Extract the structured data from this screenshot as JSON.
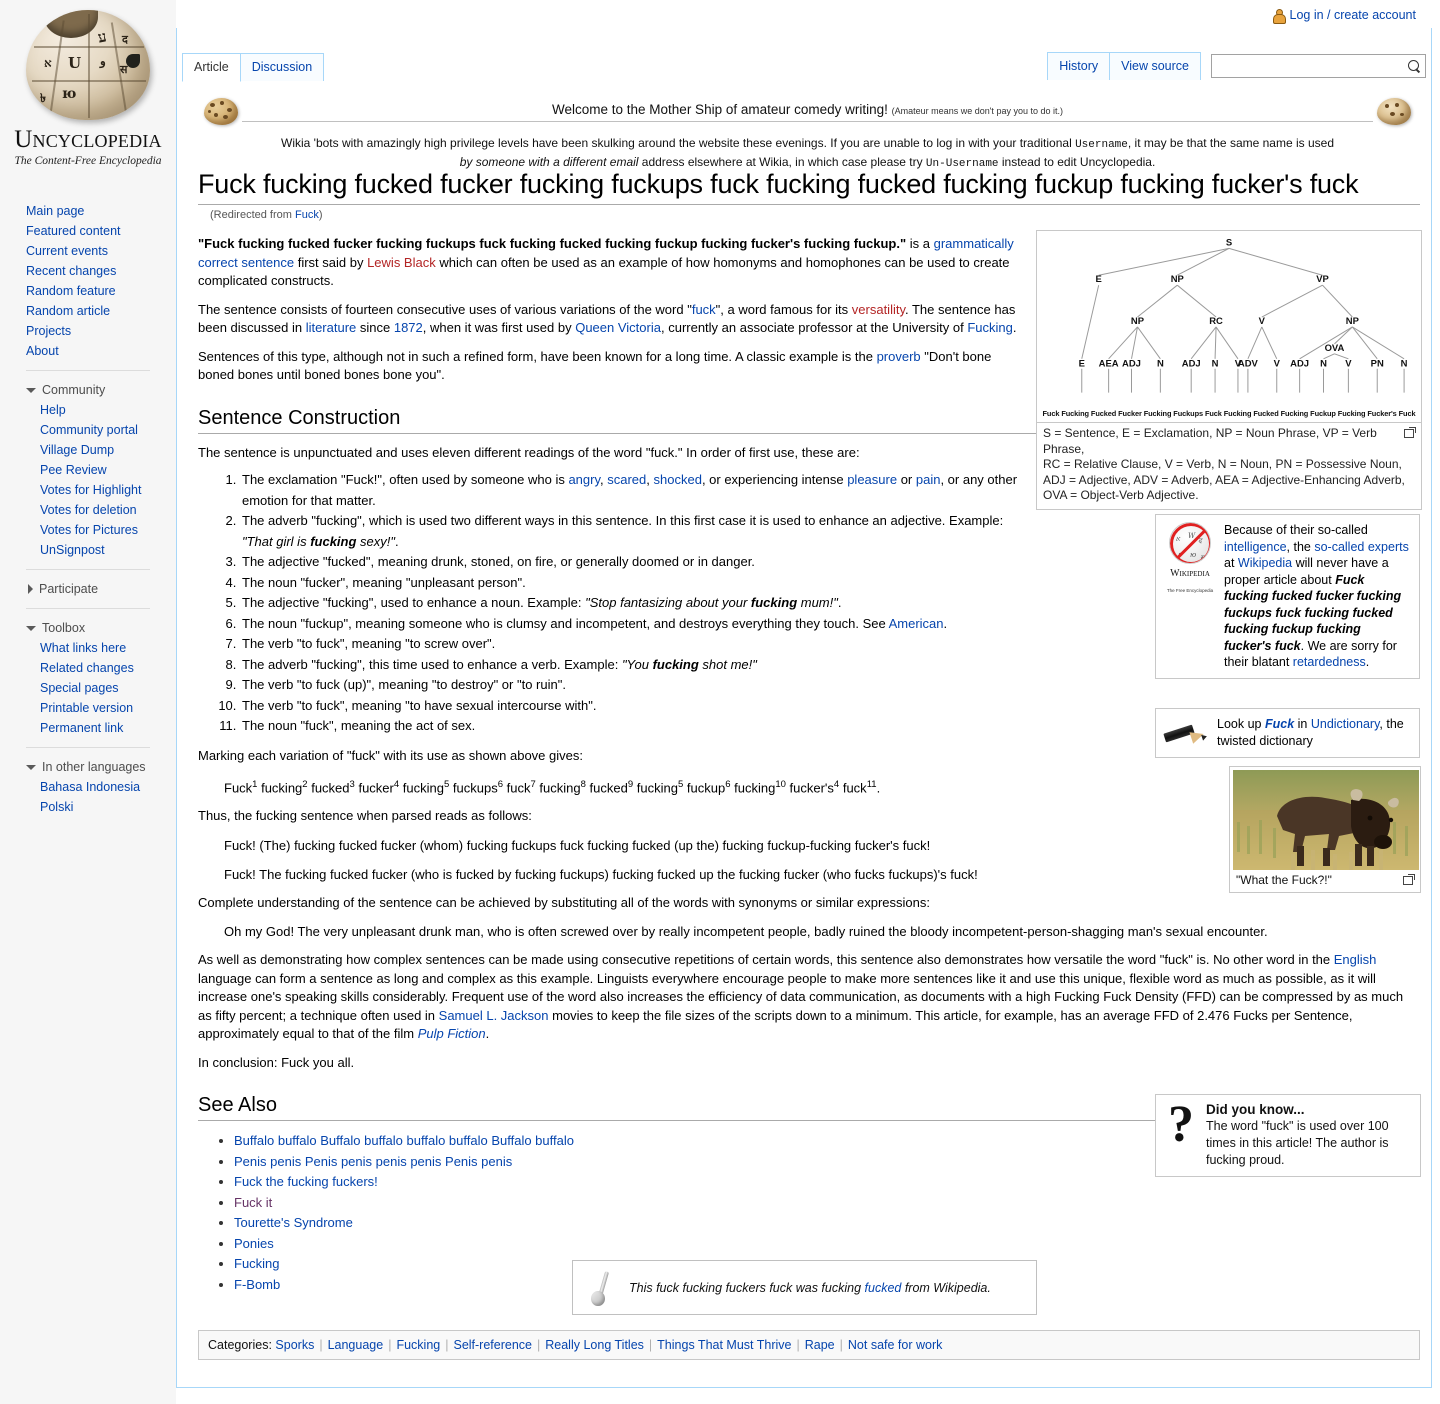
{
  "userbar": {
    "login_label": "Log in / create account"
  },
  "tabs": {
    "left": [
      {
        "label": "Article",
        "active": true
      },
      {
        "label": "Discussion",
        "active": false
      }
    ],
    "right": [
      {
        "label": "History"
      },
      {
        "label": "View source"
      }
    ]
  },
  "search": {
    "value": "",
    "placeholder": ""
  },
  "logo": {
    "name": "Uncyclopedia",
    "tagline": "The Content-Free Encyclopedia"
  },
  "sidebar": {
    "main_links": [
      "Main page",
      "Featured content",
      "Current events",
      "Recent changes",
      "Random feature",
      "Random article",
      "Projects",
      "About"
    ],
    "groups": [
      {
        "title": "Community",
        "expanded": true,
        "items": [
          "Help",
          "Community portal",
          "Village Dump",
          "Pee Review",
          "Votes for Highlight",
          "Votes for deletion",
          "Votes for Pictures",
          "UnSignpost"
        ]
      },
      {
        "title": "Participate",
        "expanded": false,
        "items": []
      },
      {
        "title": "Toolbox",
        "expanded": true,
        "items": [
          "What links here",
          "Related changes",
          "Special pages",
          "Printable version",
          "Permanent link"
        ]
      },
      {
        "title": "In other languages",
        "expanded": true,
        "items": [
          "Bahasa Indonesia",
          "Polski"
        ]
      }
    ]
  },
  "notice": {
    "headline": "Welcome to the Mother Ship of amateur comedy writing!",
    "headline_small": "(Amateur means we don't pay you to do it.)",
    "body_line1_a": "Wikia 'bots with amazingly high privilege levels have been skulking around the website these evenings. If you are unable to log in with your traditional ",
    "body_line1_mono": "Username",
    "body_line1_b": ", it may be that the same name is used",
    "body_line2_a": "by someone with a different email",
    "body_line2_b": " address elsewhere at Wikia, in which case please try ",
    "body_line2_mono": "Un-Username",
    "body_line2_c": " instead to edit Uncyclopedia."
  },
  "article": {
    "title": "Fuck fucking fucked fucker fucking fuckups fuck fucking fucked fucking fuckup fucking fucker's fuck",
    "redirect_prefix": "(Redirected from ",
    "redirect_link": "Fuck",
    "redirect_suffix": ")",
    "p1": {
      "quote": "\"Fuck fucking fucked fucker fucking fuckups fuck fucking fucked fucking fuckup fucking fucker's fucking fuckup.\"",
      "a": " is a ",
      "link1": "grammatically correct sentence",
      "b": " first said by ",
      "link2": "Lewis Black",
      "c": " which can often be used as an example of how homonyms and homophones can be used to create complicated constructs."
    },
    "p2": {
      "a": "The sentence consists of fourteen consecutive uses of various variations of the word \"",
      "link1": "fuck",
      "b": "\", a word famous for its ",
      "link2": "versatility",
      "c": ". The sentence has been discussed in ",
      "link3": "literature",
      "d": " since ",
      "link4": "1872",
      "e": ", when it was first used by ",
      "link5": "Queen Victoria",
      "f": ", currently an associate professor at the University of ",
      "link6": "Fucking",
      "g": "."
    },
    "p3": {
      "a": "Sentences of this type, although not in such a refined form, have been known for a long time. A classic example is the ",
      "link1": "proverb",
      "b": " \"Don't bone boned bones until boned bones bone you\"."
    },
    "section_construction": "Sentence Construction",
    "p4": "The sentence is unpunctuated and uses eleven different readings of the word \"fuck.\" In order of first use, these are:",
    "readings": [
      {
        "pre": "The exclamation \"Fuck!\", often used by someone who is ",
        "links": [
          "angry",
          "scared",
          "shocked"
        ],
        "mid": ", or experiencing intense ",
        "links2": [
          "pleasure",
          "pain"
        ],
        "post": ", or any other emotion for that matter."
      },
      {
        "pre": "The adverb \"fucking\", which is used two different ways in this sentence. In this first case it is used to enhance an adjective. Example: ",
        "italic_a": "\"That girl is ",
        "bold_italic": "fucking",
        "italic_b": " sexy!\"",
        "post": "."
      },
      {
        "text": "The adjective \"fucked\", meaning drunk, stoned, on fire, or generally doomed or in danger."
      },
      {
        "text": "The noun \"fucker\", meaning \"unpleasant person\"."
      },
      {
        "pre": "The adjective \"fucking\", used to enhance a noun. Example: ",
        "italic_a": "\"Stop fantasizing about your ",
        "bold_italic": "fucking",
        "italic_b": " mum!\"",
        "post": "."
      },
      {
        "pre": "The noun \"fuckup\", meaning someone who is clumsy and incompetent, and destroys everything they touch. See ",
        "links": [
          "American"
        ],
        "post": "."
      },
      {
        "text": "The verb \"to fuck\", meaning \"to screw over\"."
      },
      {
        "pre": "The adverb \"fucking\", this time used to enhance a verb. Example: ",
        "italic_a": "\"You ",
        "bold_italic": "fucking",
        "italic_b": " shot me!\"",
        "post": ""
      },
      {
        "text": "The verb \"to fuck (up)\", meaning \"to destroy\" or \"to ruin\"."
      },
      {
        "text": "The verb \"to fuck\", meaning \"to have sexual intercourse with\"."
      },
      {
        "text": "The noun \"fuck\", meaning the act of sex."
      }
    ],
    "p5": "Marking each variation of \"fuck\" with its use as shown above gives:",
    "marked_sentence": [
      {
        "w": "Fuck",
        "s": "1"
      },
      {
        "w": "fucking",
        "s": "2"
      },
      {
        "w": "fucked",
        "s": "3"
      },
      {
        "w": "fucker",
        "s": "4"
      },
      {
        "w": "fucking",
        "s": "5"
      },
      {
        "w": "fuckups",
        "s": "6"
      },
      {
        "w": "fuck",
        "s": "7"
      },
      {
        "w": "fucking",
        "s": "8"
      },
      {
        "w": "fucked",
        "s": "9"
      },
      {
        "w": "fucking",
        "s": "5"
      },
      {
        "w": "fuckup",
        "s": "6"
      },
      {
        "w": "fucking",
        "s": "10"
      },
      {
        "w": "fucker's",
        "s": "4"
      },
      {
        "w": "fuck",
        "s": "11"
      }
    ],
    "marked_end": ".",
    "p6": "Thus, the fucking sentence when parsed reads as follows:",
    "parse1": "Fuck! (The) fucking fucked fucker (whom) fucking fuckups fuck fucking fucked (up the) fucking fuckup-fucking fucker's fuck!",
    "parse2": "Fuck! The fucking fucked fucker (who is fucked by fucking fuckups) fucking fucked up the fucking fucker (who fucks fuckups)'s fuck!",
    "p7": "Complete understanding of the sentence can be achieved by substituting all of the words with synonyms or similar expressions:",
    "synonym_line": "Oh my God! The very unpleasant drunk man, who is often screwed over by really incompetent people, badly ruined the bloody incompetent-person-shagging man's sexual encounter.",
    "p8": {
      "a": "As well as demonstrating how complex sentences can be made using consecutive repetitions of certain words, this sentence also demonstrates how versatile the word \"fuck\" is. No other word in the ",
      "link1": "English",
      "b": " language can form a sentence as long and complex as this example. Linguists everywhere encourage people to make more sentences like it and use this unique, flexible word as much as possible, as it will increase one's speaking skills considerably. Frequent use of the word also increases the efficiency of data communication, as documents with a high Fucking Fuck Density (FFD) can be compressed by as much as fifty percent; a technique often used in ",
      "link2": "Samuel L. Jackson",
      "c": " movies to keep the file sizes of the scripts down to a minimum. This article, for example, has an average FFD of 2.476 Fucks per Sentence, approximately equal to that of the film ",
      "link3_italic": "Pulp Fiction",
      "d": "."
    },
    "p9": "In conclusion: Fuck you all.",
    "section_seealso": "See Also",
    "seealso": [
      {
        "label": "Buffalo buffalo Buffalo buffalo buffalo buffalo Buffalo buffalo",
        "visited": false
      },
      {
        "label": "Penis penis Penis penis penis penis Penis penis",
        "visited": false
      },
      {
        "label": "Fuck the fucking fuckers!",
        "visited": false
      },
      {
        "label": "Fuck it",
        "visited": true
      },
      {
        "label": "Tourette's Syndrome",
        "visited": false
      },
      {
        "label": "Ponies",
        "visited": false
      },
      {
        "label": "Fucking",
        "visited": false
      },
      {
        "label": "F-Bomb",
        "visited": false
      }
    ]
  },
  "tree": {
    "legend_line1": "S = Sentence, E = Exclamation, NP = Noun Phrase, VP = Verb Phrase,",
    "legend_line2": "RC = Relative Clause, V = Verb, N = Noun, PN = Possessive Noun,",
    "legend_line3": "ADJ = Adjective, ADV = Adverb, AEA = Adjective-Enhancing Adverb,",
    "legend_line4": "OVA = Object-Verb Adjective.",
    "leaf_words": "Fuck Fucking Fucked Fucker Fucking Fuckups Fuck Fucking Fucked Fucking Fuckup Fucking Fucker's Fuck",
    "nodes": {
      "root": "S",
      "level2": [
        "E",
        "NP",
        "VP"
      ],
      "level3": [
        "NP",
        "RC",
        "V",
        "NP"
      ],
      "ova": "OVA",
      "pos": [
        "E",
        "AEA",
        "ADJ",
        "N",
        "ADJ",
        "N",
        "V",
        "ADV",
        "V",
        "ADJ",
        "N",
        "V",
        "PN",
        "N"
      ]
    }
  },
  "wikibox": {
    "a": "Because of their so-called ",
    "link1": "intelligence",
    "b": ", the ",
    "link2": "so-called experts",
    "c": " at ",
    "link3": "Wikipedia",
    "d": " will never have a proper article about ",
    "bold_italic": "Fuck fucking fucked fucker fucking fuckups fuck fucking fucked fucking fuckup fucking fucker's fuck",
    "e": ". We are sorry for their blatant ",
    "link4": "retardedness",
    "f": ".",
    "logo_word": "Wikipedia",
    "logo_sub": "The Free Encyclopedia"
  },
  "undictbox": {
    "a": "Look up ",
    "bold_italic": "Fuck",
    "b": " in ",
    "link": "Undictionary",
    "c": ", the twisted dictionary"
  },
  "thumb": {
    "caption": "\"What the Fuck?!\""
  },
  "dyk": {
    "title": "Did you know...",
    "text": "The word \"fuck\" is used over 100 times in this article! The author is fucking proud."
  },
  "spork": {
    "a": "This fuck fucking fuckers fuck was fucking ",
    "link": "fucked",
    "b": " from Wikipedia."
  },
  "categories": {
    "label": "Categories:",
    "items": [
      "Sporks",
      "Language",
      "Fucking",
      "Self-reference",
      "Really Long Titles",
      "Things That Must Thrive",
      "Rape",
      "Not safe for work"
    ]
  },
  "colors": {
    "link": "#0645ad",
    "link_red": "#b32424",
    "link_visited": "#663366",
    "tab_border": "#a7d7f9",
    "sidebar_bg": "#f6f6f6"
  }
}
